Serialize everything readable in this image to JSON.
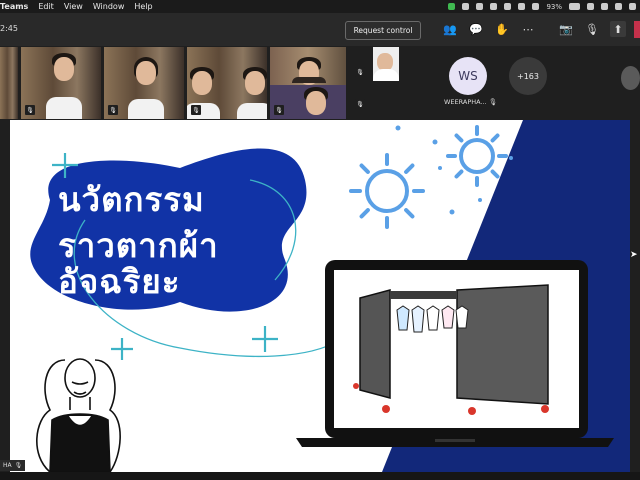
{
  "menubar": {
    "app": "Teams",
    "items": [
      "Edit",
      "View",
      "Window",
      "Help"
    ],
    "battery": "93%"
  },
  "toolbar": {
    "time": "2:45",
    "request_control": "Request control"
  },
  "participants": {
    "featured_initials": "WS",
    "featured_name": "WEERAPHA...",
    "more_count": "+163",
    "self_label": "HA"
  },
  "slide": {
    "title_lines": [
      "นวัตกรรม",
      "ราวตากผ้า",
      "อัจฉริยะ"
    ],
    "colors": {
      "blob": "#1133a6",
      "navy": "#12287a",
      "accent": "#5aa0e6",
      "teal": "#3db3c6"
    }
  }
}
